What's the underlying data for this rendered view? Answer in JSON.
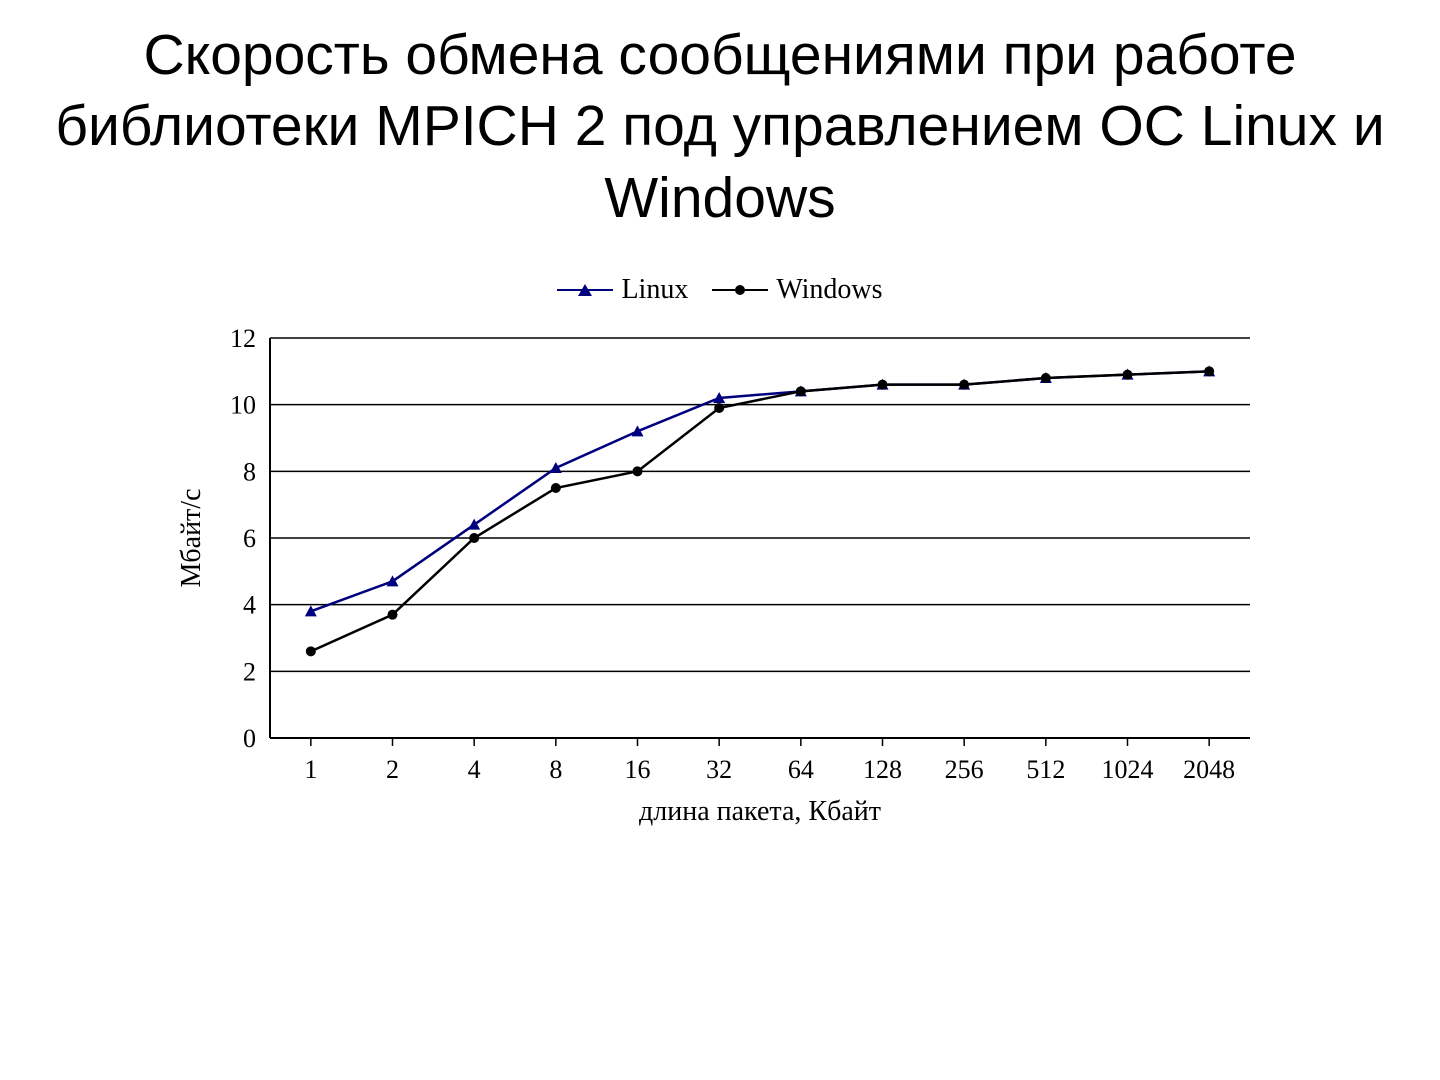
{
  "title": "Скорость обмена сообщениями при работе библиотеки MPICH 2  под управлением ОС Linux и Windows",
  "legend": {
    "linux": "Linux",
    "windows": "Windows"
  },
  "chart_data": {
    "type": "line",
    "xlabel": "длина пакета, Кбайт",
    "ylabel": "Мбайт/с",
    "ylim": [
      0,
      12
    ],
    "yticks": [
      0,
      2,
      4,
      6,
      8,
      10,
      12
    ],
    "categories": [
      "1",
      "2",
      "4",
      "8",
      "16",
      "32",
      "64",
      "128",
      "256",
      "512",
      "1024",
      "2048"
    ],
    "series": [
      {
        "name": "Linux",
        "marker": "triangle",
        "color": "#00007f",
        "values": [
          3.8,
          4.7,
          6.4,
          8.1,
          9.2,
          10.2,
          10.4,
          10.6,
          10.6,
          10.8,
          10.9,
          11.0
        ]
      },
      {
        "name": "Windows",
        "marker": "circle",
        "color": "#000000",
        "values": [
          2.6,
          3.7,
          6.0,
          7.5,
          8.0,
          9.9,
          10.4,
          10.6,
          10.6,
          10.8,
          10.9,
          11.0
        ]
      }
    ]
  }
}
